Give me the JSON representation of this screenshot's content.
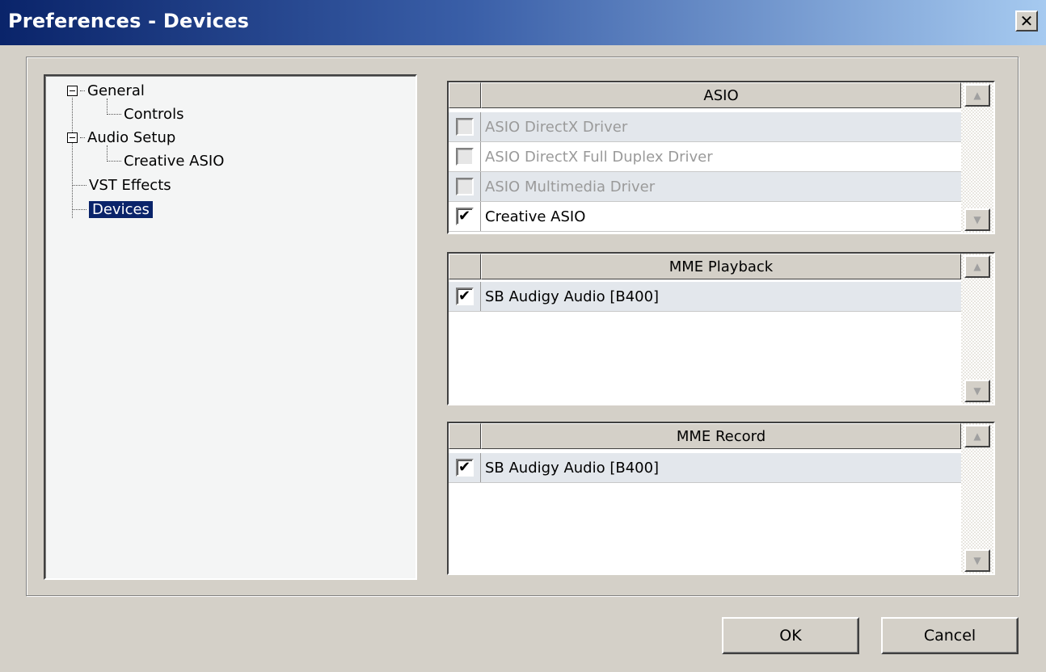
{
  "window": {
    "title": "Preferences - Devices",
    "close_glyph": "✕"
  },
  "tree": {
    "items": [
      {
        "label": "General",
        "expander": "minus"
      },
      {
        "label": "Controls"
      },
      {
        "label": "Audio Setup",
        "expander": "minus"
      },
      {
        "label": "Creative ASIO"
      },
      {
        "label": "VST Effects"
      },
      {
        "label": "Devices",
        "selected": true
      }
    ]
  },
  "asio": {
    "header": "ASIO",
    "rows": [
      {
        "label": "ASIO DirectX Driver",
        "checked": false,
        "enabled": false
      },
      {
        "label": "ASIO DirectX Full Duplex Driver",
        "checked": false,
        "enabled": false
      },
      {
        "label": "ASIO Multimedia Driver",
        "checked": false,
        "enabled": false
      },
      {
        "label": "Creative ASIO",
        "checked": true,
        "enabled": true
      }
    ]
  },
  "mme_playback": {
    "header": "MME Playback",
    "rows": [
      {
        "label": "SB Audigy Audio [B400]",
        "checked": true,
        "enabled": true
      }
    ]
  },
  "mme_record": {
    "header": "MME Record",
    "rows": [
      {
        "label": "SB Audigy Audio [B400]",
        "checked": true,
        "enabled": true
      }
    ]
  },
  "scroll_icons": {
    "up": "▲",
    "down": "▼"
  },
  "check_glyph": "✔",
  "buttons": {
    "ok": "OK",
    "cancel": "Cancel"
  }
}
